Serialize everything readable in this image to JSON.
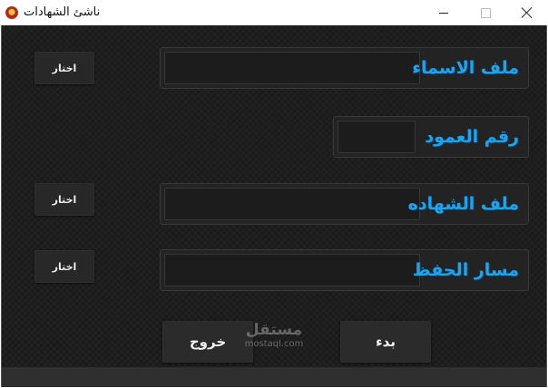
{
  "window": {
    "title": "ناشئ الشهادات",
    "controls": [
      "minimize",
      "maximize",
      "close"
    ],
    "icon": "app-icon"
  },
  "form": {
    "names_file": {
      "label": "ملف الاسماء",
      "value": "",
      "browse_label": "اختار"
    },
    "column_number": {
      "label": "رقم العمود",
      "value": ""
    },
    "certificate_file": {
      "label": "ملف الشهاده",
      "value": "",
      "browse_label": "اختار"
    },
    "save_path": {
      "label": "مسار الحفظ",
      "value": "",
      "browse_label": "اختار"
    }
  },
  "actions": {
    "exit_label": "خروج",
    "start_label": "بدء"
  },
  "watermark": {
    "arabic": "مستقل",
    "latin": "mostaql.com"
  },
  "colors": {
    "label_accent": "#1fa3ee",
    "background": "#1e1e1e",
    "panel": "#232323"
  }
}
